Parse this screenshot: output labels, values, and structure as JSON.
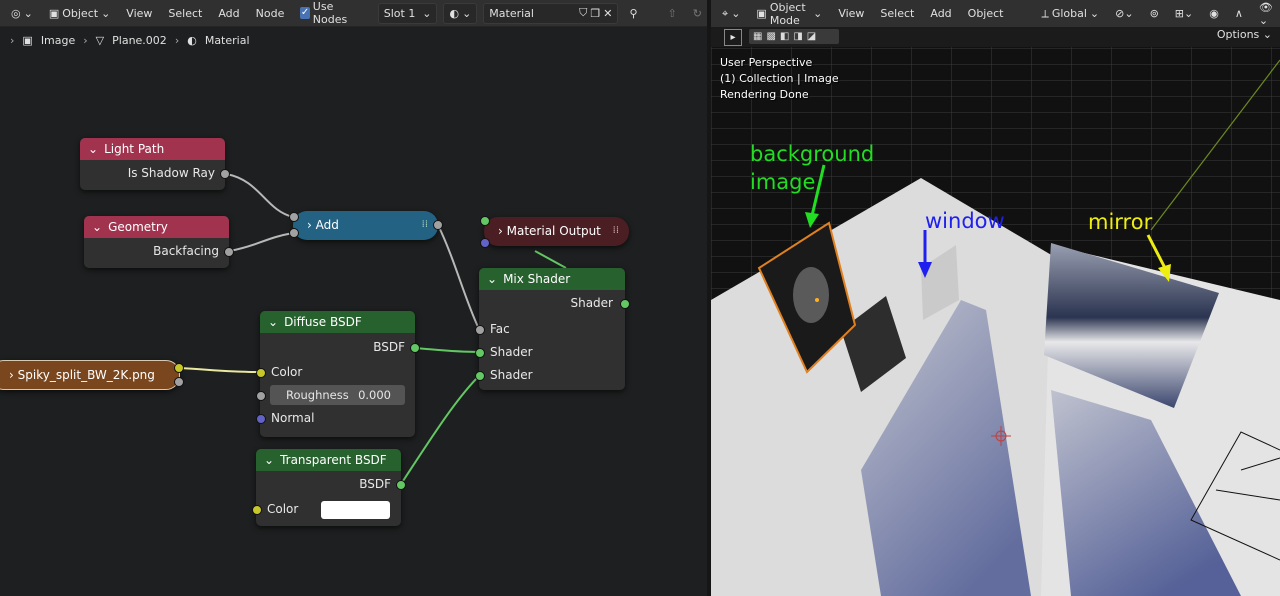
{
  "node_editor": {
    "header": {
      "editor_type_icon": "node-editor-icon",
      "object_mode": "Object",
      "menu": [
        "View",
        "Select",
        "Add",
        "Node"
      ],
      "use_nodes_label": "Use Nodes",
      "use_nodes_checked": true,
      "slot": "Slot 1",
      "material_name": "Material"
    },
    "breadcrumb": [
      "Image",
      "Plane.002",
      "Material"
    ],
    "nodes": {
      "light_path": {
        "title": "Light Path",
        "output": "Is Shadow Ray",
        "color": "#a1334f"
      },
      "geometry": {
        "title": "Geometry",
        "output": "Backfacing",
        "color": "#a1334f"
      },
      "add": {
        "title": "Add",
        "color": "#246283"
      },
      "material_output": {
        "title": "Material Output",
        "color": "#4a1e23"
      },
      "mix_shader": {
        "title": "Mix Shader",
        "output": "Shader",
        "inputs": [
          "Fac",
          "Shader",
          "Shader"
        ],
        "color": "#27612e"
      },
      "diffuse": {
        "title": "Diffuse BSDF",
        "output": "BSDF",
        "color_label": "Color",
        "roughness_label": "Roughness",
        "roughness_value": "0.000",
        "normal_label": "Normal",
        "color": "#27612e"
      },
      "image": {
        "title": "Spiky_split_BW_2K.png",
        "color": "#79461d"
      },
      "transparent": {
        "title": "Transparent BSDF",
        "output": "BSDF",
        "color_label": "Color",
        "swatch": "#ffffff",
        "color": "#27612e"
      }
    }
  },
  "viewport": {
    "header": {
      "mode": "Object Mode",
      "menu": [
        "View",
        "Select",
        "Add",
        "Object"
      ],
      "transform_orientation": "Global",
      "options_label": "Options"
    },
    "overlay": {
      "perspective": "User Perspective",
      "collection": "(1) Collection | Image",
      "status": "Rendering Done"
    },
    "annotations": {
      "background_image_line1": "background",
      "background_image_line2": "image",
      "window": "window",
      "mirror": "mirror",
      "colors": {
        "background": "#22dd22",
        "window": "#2020ee",
        "mirror": "#eeee10"
      }
    }
  }
}
